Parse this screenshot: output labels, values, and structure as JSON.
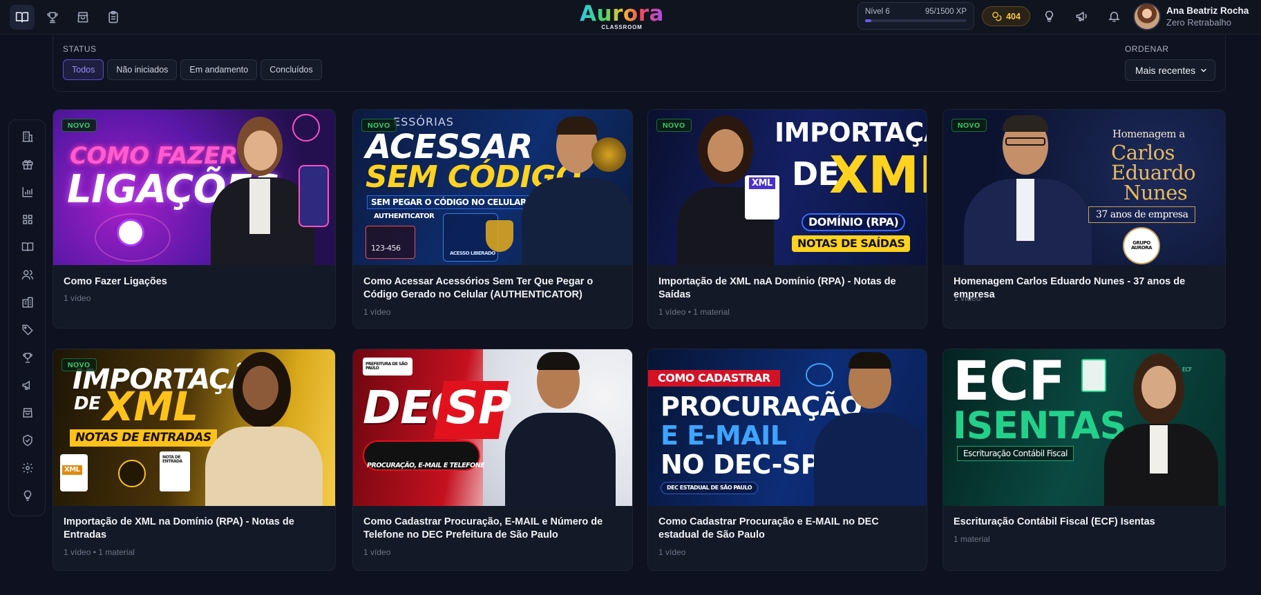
{
  "app": {
    "logo_text": "Aurora",
    "logo_sub": "CLASSROOM"
  },
  "level": {
    "label": "Nível 6",
    "xp": "95/1500 XP",
    "progress": 0.063
  },
  "coins": {
    "value": "404"
  },
  "user": {
    "name": "Ana Beatriz Rocha",
    "subtitle": "Zero Retrabalho"
  },
  "topnav": {
    "icons": [
      "book-icon",
      "trophy-icon",
      "shopping-bag-icon",
      "clipboard-icon"
    ],
    "active": 0
  },
  "header_icons": [
    "lightbulb-icon",
    "megaphone-icon",
    "bell-icon"
  ],
  "filters": {
    "status_label": "STATUS",
    "chips": [
      "Todos",
      "Não iniciados",
      "Em andamento",
      "Concluídos"
    ],
    "active_chip": 0,
    "order_label": "ORDENAR",
    "order_value": "Mais recentes"
  },
  "sidebar": {
    "icons": [
      "building-icon",
      "gift-icon",
      "bar-chart-icon",
      "grid-icon",
      "book-icon",
      "users-icon",
      "building-alt-icon",
      "tag-icon",
      "trophy-icon",
      "megaphone-icon",
      "shopping-bag-icon",
      "shield-check-icon",
      "settings-icon",
      "lightbulb-icon"
    ]
  },
  "courses": [
    {
      "title": "Como Fazer Ligações",
      "meta": "1 vídeo",
      "badge": "NOVO",
      "thumb": {
        "bg": "#3a1370",
        "accent": "#ff3fb0",
        "line1": "COMO FAZER",
        "line2": "LIGAÇÕES"
      }
    },
    {
      "title": "Como Acessar Acessórios Sem Ter Que Pegar o Código Gerado no Celular (AUTHENTICATOR)",
      "meta": "1 vídeo",
      "badge": "NOVO",
      "thumb": {
        "bg": "#0b1e48",
        "accent": "#ffd21f",
        "line0": "ESSÓRIAS",
        "line1": "ACESSAR",
        "line2": "SEM CÓDIGO",
        "line3": "SEM PEGAR O CÓDIGO NO CELULAR",
        "line4": "AUTHENTICATOR",
        "line5": "123-456",
        "line6": "ACESSO LIBERADO"
      }
    },
    {
      "title": "Importação de XML naA Domínio (RPA) - Notas de Saídas",
      "meta": "1 vídeo • 1 material",
      "badge": "NOVO",
      "thumb": {
        "bg": "#0d1438",
        "accent": "#ffd21f",
        "line1": "IMPORTAÇÃO",
        "line2": "DE",
        "line3": "XML",
        "line4": "DOMÍNIO (RPA)",
        "line5": "NOTAS DE SAÍDAS",
        "line6": "XML"
      }
    },
    {
      "title": "Homenagem Carlos Eduardo Nunes - 37 anos de empresa",
      "meta": "1 vídeo",
      "badge": "NOVO",
      "thumb": {
        "bg": "#0c1530",
        "accent": "#e9b95c",
        "line1": "Homenagem a",
        "line2": "Carlos",
        "line3": "Eduardo",
        "line4": "Nunes",
        "line5": "37 anos de empresa",
        "line6": "GRUPO AURORA"
      }
    },
    {
      "title": "Importação de XML na Domínio (RPA) - Notas de Entradas",
      "meta": "1 vídeo • 1 material",
      "badge": "NOVO",
      "thumb": {
        "bg": "#2a1d05",
        "accent": "#ffc21a",
        "line1": "IMPORTAÇÃO",
        "line2": "DE",
        "line3": "XML",
        "line4": "NOTAS DE ENTRADAS",
        "line5": "XML",
        "line6": "NOTA DE ENTRADA"
      }
    },
    {
      "title": "Como Cadastrar Procuração, E-MAIL e Número de Telefone no DEC Prefeitura de São Paulo",
      "meta": "1 vídeo",
      "badge": "",
      "thumb": {
        "bg": "#b20d1a",
        "accent": "#ffffff",
        "line1": "DEC",
        "line2": "SP",
        "line3": "PROCURAÇÃO, E-MAIL E TELEFONE",
        "line4": "PREFEITURA DE SÃO PAULO"
      }
    },
    {
      "title": "Como Cadastrar Procuração e E-MAIL no DEC estadual de São Paulo",
      "meta": "1 vídeo",
      "badge": "",
      "thumb": {
        "bg": "#0b1f4d",
        "accent": "#3fa4ff",
        "line1": "COMO CADASTRAR",
        "line2": "PROCURAÇÃO",
        "line3": "E E-MAIL",
        "line4": "NO DEC-SP",
        "line5": "DEC ESTADUAL DE SÃO PAULO"
      }
    },
    {
      "title": "Escrituração Contábil Fiscal (ECF) Isentas",
      "meta": "1 material",
      "badge": "",
      "thumb": {
        "bg": "#06312c",
        "accent": "#22d08a",
        "line1": "ECF",
        "line2": "ISENTAS",
        "line3": "Escrituração Contábil Fiscal",
        "line4": "ECF"
      }
    }
  ]
}
